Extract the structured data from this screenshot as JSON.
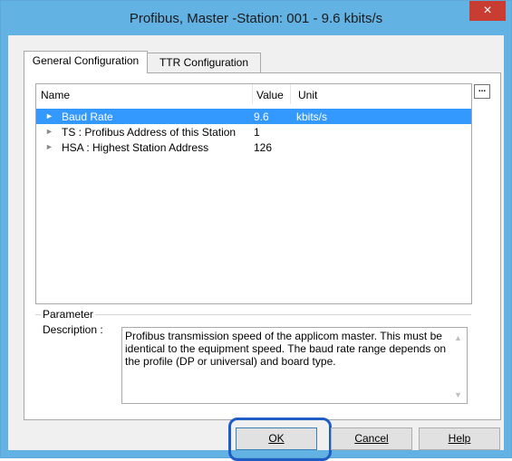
{
  "window": {
    "title": "Profibus, Master -Station: 001 - 9.6 kbits/s",
    "close_glyph": "×"
  },
  "tabs": [
    {
      "label": "General Configuration",
      "active": true
    },
    {
      "label": "TTR Configuration",
      "active": false
    }
  ],
  "table": {
    "columns": [
      "Name",
      "Value",
      "Unit"
    ],
    "rows": [
      {
        "name": "Baud Rate",
        "value": "9.6",
        "unit": "kbits/s",
        "selected": true
      },
      {
        "name": "TS : Profibus Address of this Station",
        "value": "1",
        "unit": ""
      },
      {
        "name": "HSA : Highest Station Address",
        "value": "126",
        "unit": ""
      }
    ],
    "expand_icon": "arrow-right-icon"
  },
  "ellipsis_button": "...",
  "parameter": {
    "group_label": "Parameter",
    "description_label": "Description :",
    "description_text": "Profibus transmission speed of the applicom master. This must be identical to the equipment speed. The baud rate range depends on the profile (DP or universal) and board type."
  },
  "buttons": {
    "ok": "OK",
    "cancel": "Cancel",
    "help": "Help"
  },
  "colors": {
    "titlebar": "#62b2e4",
    "selection": "#3399ff",
    "close": "#c83c32",
    "highlight": "#1e5ec4"
  }
}
